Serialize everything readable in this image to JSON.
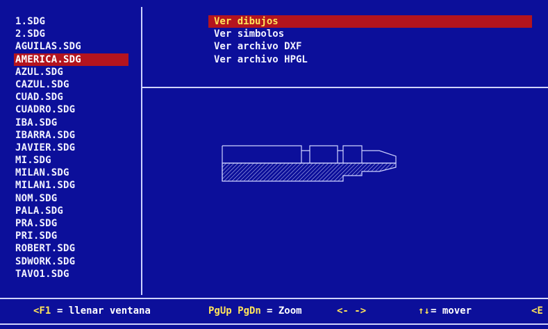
{
  "files": [
    {
      "name": "1.SDG",
      "selected": false
    },
    {
      "name": "2.SDG",
      "selected": false
    },
    {
      "name": "AGUILAS.SDG",
      "selected": false
    },
    {
      "name": "AMERICA.SDG",
      "selected": true
    },
    {
      "name": "AZUL.SDG",
      "selected": false
    },
    {
      "name": "CAZUL.SDG",
      "selected": false
    },
    {
      "name": "CUAD.SDG",
      "selected": false
    },
    {
      "name": "CUADRO.SDG",
      "selected": false
    },
    {
      "name": "IBA.SDG",
      "selected": false
    },
    {
      "name": "IBARRA.SDG",
      "selected": false
    },
    {
      "name": "JAVIER.SDG",
      "selected": false
    },
    {
      "name": "MI.SDG",
      "selected": false
    },
    {
      "name": "MILAN.SDG",
      "selected": false
    },
    {
      "name": "MILAN1.SDG",
      "selected": false
    },
    {
      "name": "NOM.SDG",
      "selected": false
    },
    {
      "name": "PALA.SDG",
      "selected": false
    },
    {
      "name": "PRA.SDG",
      "selected": false
    },
    {
      "name": "PRI.SDG",
      "selected": false
    },
    {
      "name": "ROBERT.SDG",
      "selected": false
    },
    {
      "name": "SDWORK.SDG",
      "selected": false
    },
    {
      "name": "TAVO1.SDG",
      "selected": false
    }
  ],
  "menu": [
    {
      "label": "Ver dibujos",
      "selected": true
    },
    {
      "label": "Ver simbolos",
      "selected": false
    },
    {
      "label": "Ver archivo DXF",
      "selected": false
    },
    {
      "label": "Ver archivo HPGL",
      "selected": false
    }
  ],
  "status": {
    "f1_key": "<F1",
    "f1_text": " = llenar ventana",
    "zoom_keys": "PgUp PgDn",
    "zoom_text": " = Zoom",
    "arrows_lr": "<- ->",
    "arrows_ud": "↑↓",
    "move_text": " = mover",
    "trailing": "<E"
  },
  "colors": {
    "background": "#0c0f9a",
    "highlight": "#b4141e",
    "text": "#f2f2ff",
    "accent": "#ffe45a"
  }
}
